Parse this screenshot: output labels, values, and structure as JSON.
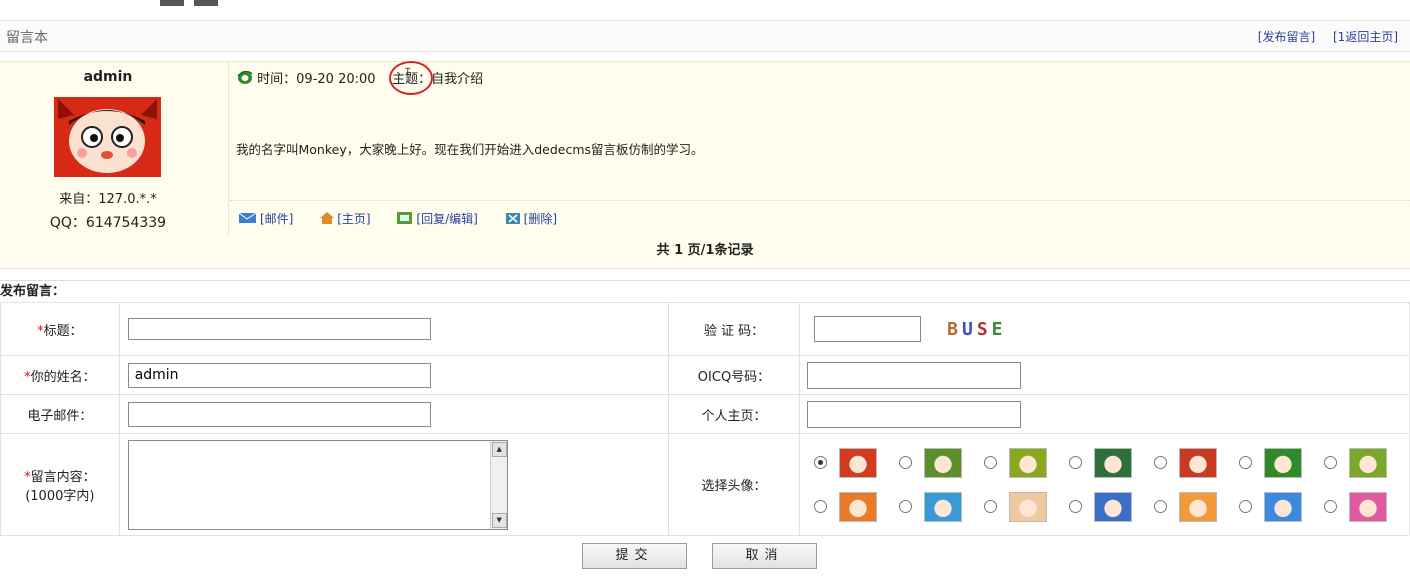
{
  "header": {
    "title": "留言本",
    "links": [
      "[发布留言]",
      "[1返回主页]"
    ]
  },
  "message": {
    "author": "admin",
    "from": "来自：127.0.*.*",
    "qq": "QQ：614754339",
    "time_label": "时间：",
    "time_value": "09-20 20:00",
    "subject_label": "主题：",
    "subject_value": "自我介绍",
    "body": "我的名字叫Monkey，大家晚上好。现在我们开始进入dedecms留言板仿制的学习。",
    "actions": [
      "[邮件]",
      "[主页]",
      "[回复/编辑]",
      "[删除]"
    ]
  },
  "pager": "共 1 页/1条记录",
  "form": {
    "section_title": "发布留言：",
    "required_mark": "*",
    "title_label": "标题：",
    "name_label": "你的姓名：",
    "email_label": "电子邮件：",
    "content_label": "留言内容：",
    "content_hint": "(1000字内)",
    "captcha_label": "验 证 码：",
    "oicq_label": "OICQ号码：",
    "homepage_label": "个人主页：",
    "avatar_label": "选择头像：",
    "values": {
      "title": "",
      "name": "admin",
      "email": "",
      "content": "",
      "captcha": "",
      "oicq": "",
      "homepage": ""
    },
    "captcha_text": [
      "B",
      "U",
      "S",
      "E"
    ],
    "avatar_colors": [
      "#d23b1e",
      "#5a8f2a",
      "#8aa81d",
      "#2f6f3a",
      "#c93a22",
      "#2f8a2a",
      "#7aa82a",
      "#e87a28",
      "#3a9ad6",
      "#f1c8a0",
      "#3a6fc8",
      "#f09a3a",
      "#3a8ae0",
      "#e05aa0"
    ],
    "selected_avatar": 0,
    "submit": "提交",
    "cancel": "取消"
  }
}
